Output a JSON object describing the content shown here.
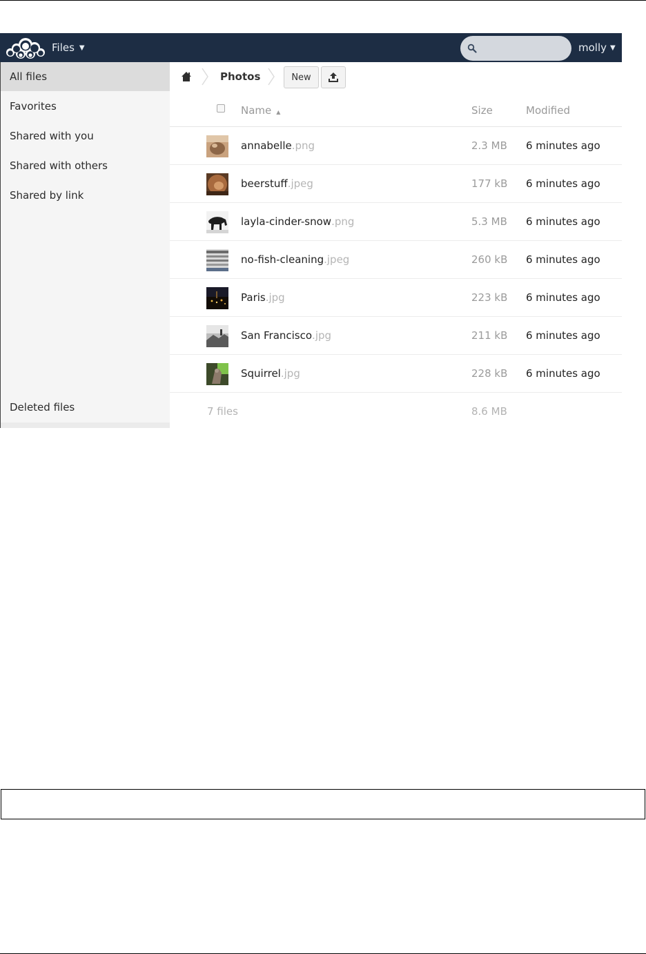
{
  "header": {
    "app_name": "Files",
    "search_placeholder": "",
    "user_name": "molly",
    "bg_color": "#1d2d44"
  },
  "sidebar": {
    "items": [
      {
        "label": "All files",
        "icon": "none",
        "active": true
      },
      {
        "label": "Favorites",
        "icon": "none",
        "active": false
      },
      {
        "label": "Shared with you",
        "icon": "none",
        "active": false
      },
      {
        "label": "Shared with others",
        "icon": "none",
        "active": false
      },
      {
        "label": "Shared by link",
        "icon": "none",
        "active": false
      }
    ],
    "deleted_label": "Deleted files"
  },
  "breadcrumb": {
    "home_icon": "home-icon",
    "current": "Photos"
  },
  "toolbar": {
    "new_label": "New",
    "upload_icon": "upload-icon"
  },
  "table": {
    "headers": {
      "name": "Name",
      "sort_indicator": "▲",
      "size": "Size",
      "modified": "Modified"
    },
    "rows": [
      {
        "base": "annabelle",
        "ext": ".png",
        "size": "2.3 MB",
        "modified": "6 minutes ago"
      },
      {
        "base": "beerstuff",
        "ext": ".jpeg",
        "size": "177 kB",
        "modified": "6 minutes ago"
      },
      {
        "base": "layla-cinder-snow",
        "ext": ".png",
        "size": "5.3 MB",
        "modified": "6 minutes ago"
      },
      {
        "base": "no-fish-cleaning",
        "ext": ".jpeg",
        "size": "260 kB",
        "modified": "6 minutes ago"
      },
      {
        "base": "Paris",
        "ext": ".jpg",
        "size": "223 kB",
        "modified": "6 minutes ago"
      },
      {
        "base": "San Francisco",
        "ext": ".jpg",
        "size": "211 kB",
        "modified": "6 minutes ago"
      },
      {
        "base": "Squirrel",
        "ext": ".jpg",
        "size": "228 kB",
        "modified": "6 minutes ago"
      }
    ],
    "summary": {
      "count": "7 files",
      "total_size": "8.6 MB"
    }
  }
}
